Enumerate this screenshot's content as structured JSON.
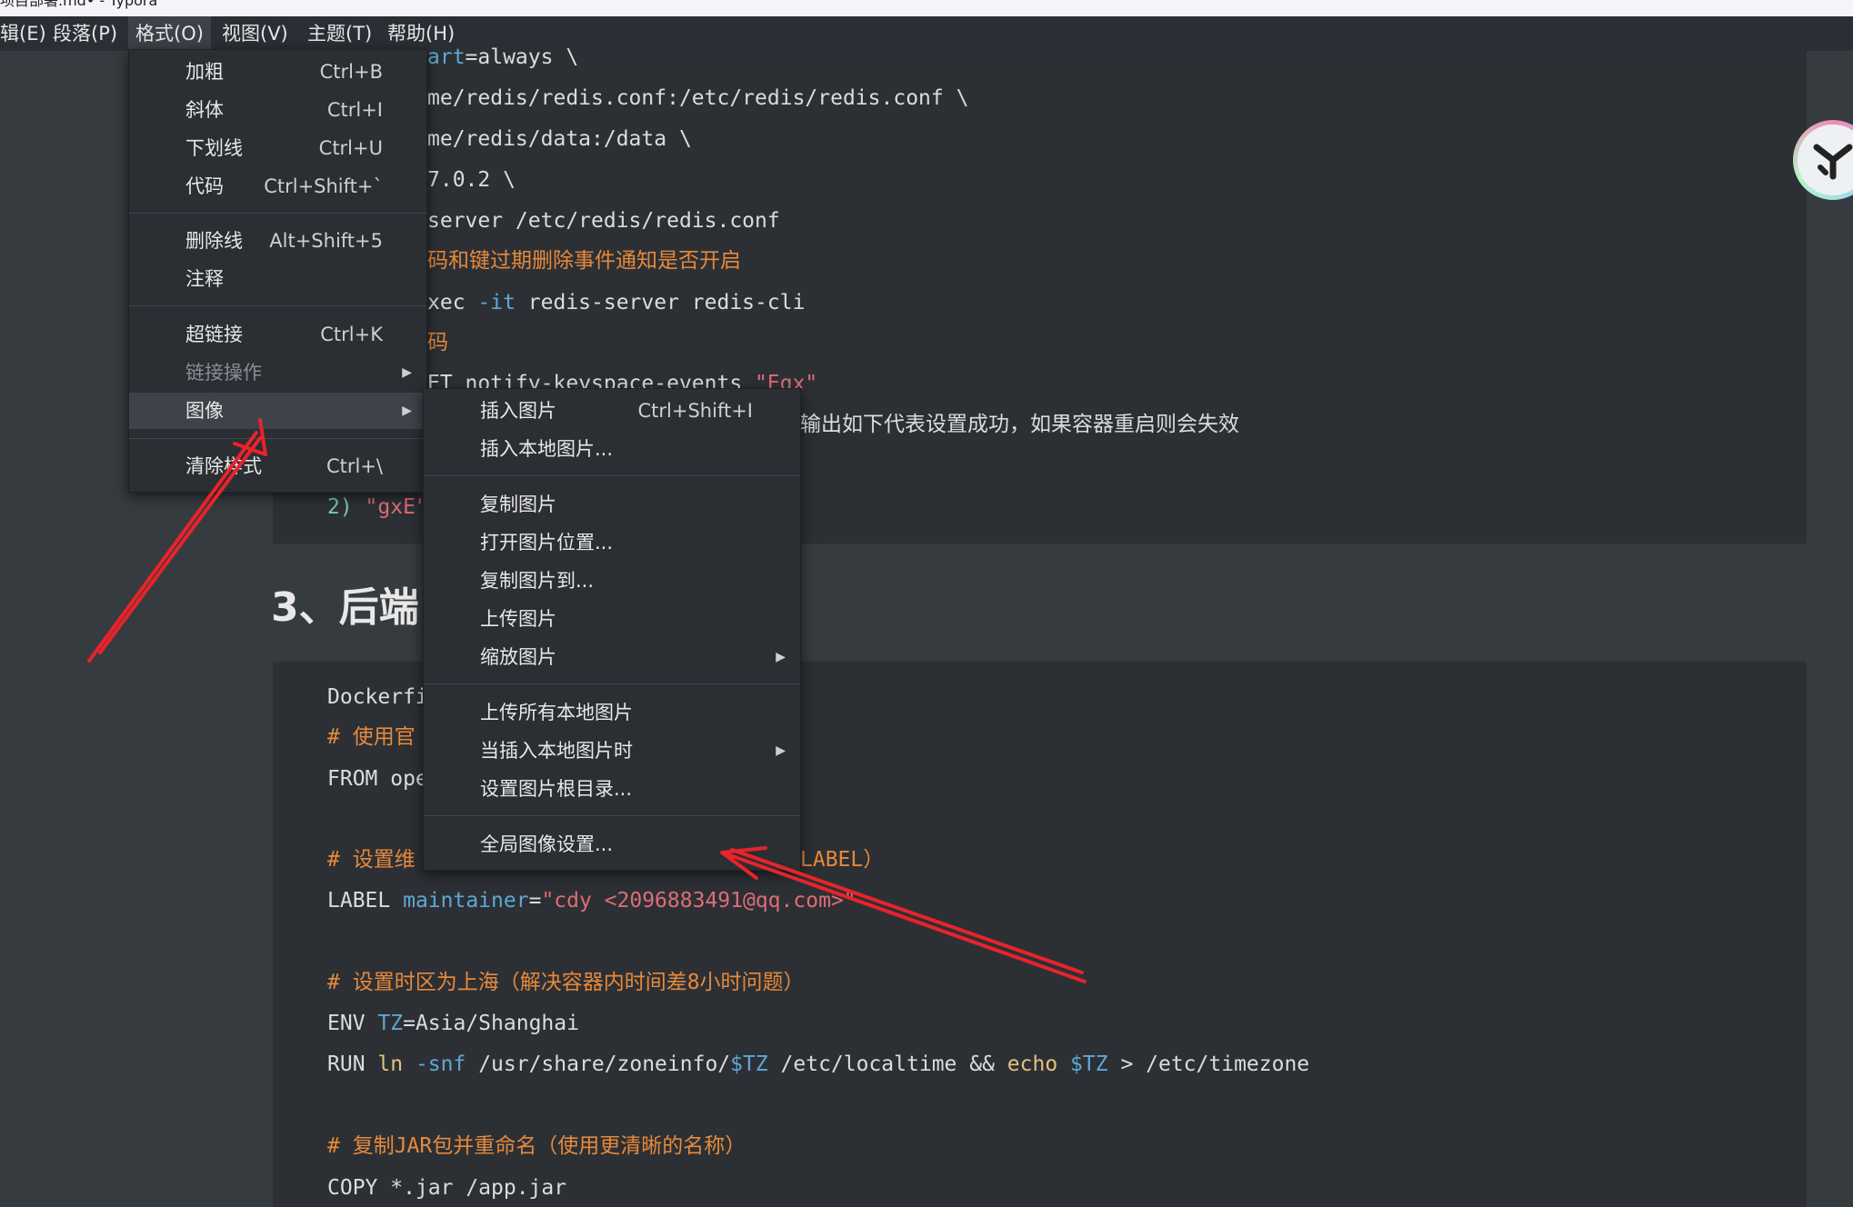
{
  "window": {
    "title": "项目部署.md• - Typora"
  },
  "menubar": [
    {
      "label": "辑(E)"
    },
    {
      "label": "段落(P)"
    },
    {
      "label": "格式(O)"
    },
    {
      "label": "视图(V)"
    },
    {
      "label": "主题(T)"
    },
    {
      "label": "帮助(H)"
    }
  ],
  "format_menu": [
    {
      "label": "加粗",
      "shortcut": "Ctrl+B"
    },
    {
      "label": "斜体",
      "shortcut": "Ctrl+I"
    },
    {
      "label": "下划线",
      "shortcut": "Ctrl+U"
    },
    {
      "label": "代码",
      "shortcut": "Ctrl+Shift+`"
    },
    {
      "label": "删除线",
      "shortcut": "Alt+Shift+5"
    },
    {
      "label": "注释",
      "shortcut": ""
    },
    {
      "label": "超链接",
      "shortcut": "Ctrl+K"
    },
    {
      "label": "链接操作",
      "shortcut": ""
    },
    {
      "label": "图像",
      "shortcut": ""
    },
    {
      "label": "清除样式",
      "shortcut": "Ctrl+\\"
    }
  ],
  "image_menu": [
    {
      "label": "插入图片",
      "shortcut": "Ctrl+Shift+I"
    },
    {
      "label": "插入本地图片...",
      "shortcut": ""
    },
    {
      "label": "复制图片",
      "shortcut": ""
    },
    {
      "label": "打开图片位置...",
      "shortcut": ""
    },
    {
      "label": "复制图片到...",
      "shortcut": ""
    },
    {
      "label": "上传图片",
      "shortcut": ""
    },
    {
      "label": "缩放图片",
      "shortcut": ""
    },
    {
      "label": "上传所有本地图片",
      "shortcut": ""
    },
    {
      "label": "当插入本地图片时",
      "shortcut": ""
    },
    {
      "label": "设置图片根目录...",
      "shortcut": ""
    },
    {
      "label": "全局图像设置...",
      "shortcut": ""
    }
  ],
  "top_code": {
    "l1a": "art",
    "l1b": "=always \\",
    "l2": "me/redis/redis.conf:/etc/redis/redis.conf \\",
    "l3": "me/redis/data:/data \\",
    "l4": "7.0.2 \\",
    "l5": "server /etc/redis/redis.conf",
    "l6": "码和键过期删除事件通知是否开启",
    "l7a": "xec ",
    "l7b": "-it",
    "l7c": " redis-server redis-cli",
    "l8": "码",
    "l9a": "ET notify-keyspace-events ",
    "l9b": "\"Egx\"",
    "l10": "输出如下代表设置成功，如果容器重启则会失效",
    "l11a": "2) ",
    "l11b": "\"gxE\""
  },
  "heading": {
    "text": "3、后端"
  },
  "docker_code": {
    "d1": "Dockerfi",
    "d2": "# 使用官",
    "d3a": "FROM ope",
    "d4": "# 设置维",
    "d4b": "LABEL）",
    "d5a": "LABEL ",
    "d5b": "maintainer",
    "d5c": "=",
    "d5d": "\"cdy <2096883491@qq.com>\"",
    "d6": "# 设置时区为上海（解决容器内时间差8小时问题）",
    "d7a": "ENV ",
    "d7b": "TZ",
    "d7c": "=Asia/Shanghai",
    "d8a": "RUN ",
    "d8b": "ln",
    "d8c": " ",
    "d8d": "-snf",
    "d8e": " /usr/share/zoneinfo/",
    "d8f": "$TZ",
    "d8g": " /etc/localtime && ",
    "d8h": "echo",
    "d8i": " ",
    "d8j": "$TZ",
    "d8k": " > /etc/timezone",
    "d9": "# 复制JAR包并重命名（使用更清晰的名称）",
    "d10": "COPY *.jar /app.jar"
  },
  "icons": {
    "arrow": "triangle-right-icon",
    "badge": "assistant-logo-icon",
    "annotation": "red-arrow-annotation"
  },
  "colors": {
    "menu_bg": "#2b2e33",
    "hover": "#3e434a",
    "editor_bg": "#363b40",
    "code_bg": "#2c3035",
    "annotation": "#e8232a"
  }
}
